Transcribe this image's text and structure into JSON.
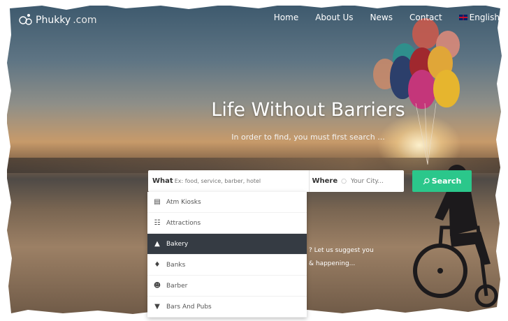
{
  "nav": {
    "logo": "Phukky",
    "logo_domain": ".com",
    "items": [
      "Home",
      "About Us",
      "News",
      "Contact"
    ],
    "language": "English"
  },
  "hero": {
    "title": "Life Without Barriers",
    "subtitle": "In order to find, you must first search ..."
  },
  "search": {
    "what_label": "What",
    "what_placeholder": "Ex: food, service, barber, hotel",
    "where_label": "Where",
    "where_placeholder": "Your City...",
    "button_label": "Search"
  },
  "dropdown": {
    "items": [
      {
        "label": "Atm Kiosks",
        "icon": "atm-icon"
      },
      {
        "label": "Attractions",
        "icon": "landmark-icon"
      },
      {
        "label": "Bakery",
        "icon": "bakery-icon",
        "active": true
      },
      {
        "label": "Banks",
        "icon": "money-bag-icon"
      },
      {
        "label": "Barber",
        "icon": "barber-icon"
      },
      {
        "label": "Bars And Pubs",
        "icon": "cocktail-icon"
      }
    ]
  },
  "aside": {
    "line1": "? Let us suggest you",
    "line2": "& happening..."
  },
  "colors": {
    "accent": "#2bc78b",
    "dropdown_active": "#353b43"
  }
}
